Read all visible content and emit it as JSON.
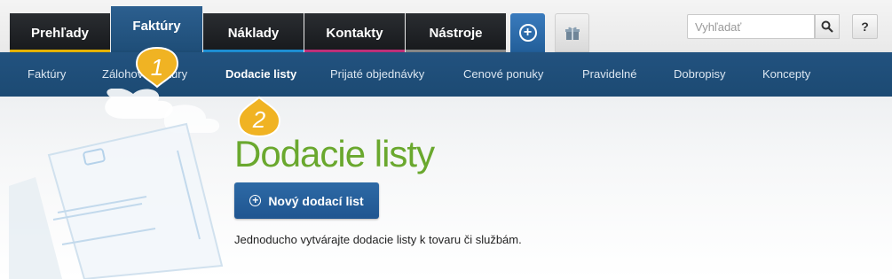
{
  "main_tabs": [
    {
      "label": "Prehľady",
      "stripe": "#e8b400"
    },
    {
      "label": "Faktúry",
      "stripe": "#2c5f8f",
      "active": true
    },
    {
      "label": "Náklady",
      "stripe": "#1e90d6"
    },
    {
      "label": "Kontakty",
      "stripe": "#c0307a"
    },
    {
      "label": "Nástroje",
      "stripe": "#888888"
    }
  ],
  "toolbar": {
    "add_icon": "plus-circle-icon",
    "gift_icon": "gift-icon",
    "search_placeholder": "Vyhľadať",
    "search_icon": "magnifier-icon",
    "help_label": "?"
  },
  "subnav": {
    "items": [
      {
        "label": "Faktúry"
      },
      {
        "label": "Zálohové faktúry"
      },
      {
        "label": "Dodacie listy",
        "active": true
      },
      {
        "label": "Prijaté objednávky"
      },
      {
        "label": "Cenové ponuky"
      },
      {
        "label": "Pravidelné"
      },
      {
        "label": "Dobropisy"
      },
      {
        "label": "Koncepty"
      }
    ]
  },
  "badges": [
    "1",
    "2"
  ],
  "main": {
    "title": "Dodacie listy",
    "new_button_label": "Nový dodací list",
    "description": "Jednoducho vytvárajte dodacie listy k tovaru či službám."
  },
  "colors": {
    "accent_green": "#6aa82e",
    "nav_blue": "#1c4a73",
    "badge_yellow": "#f0b323"
  }
}
